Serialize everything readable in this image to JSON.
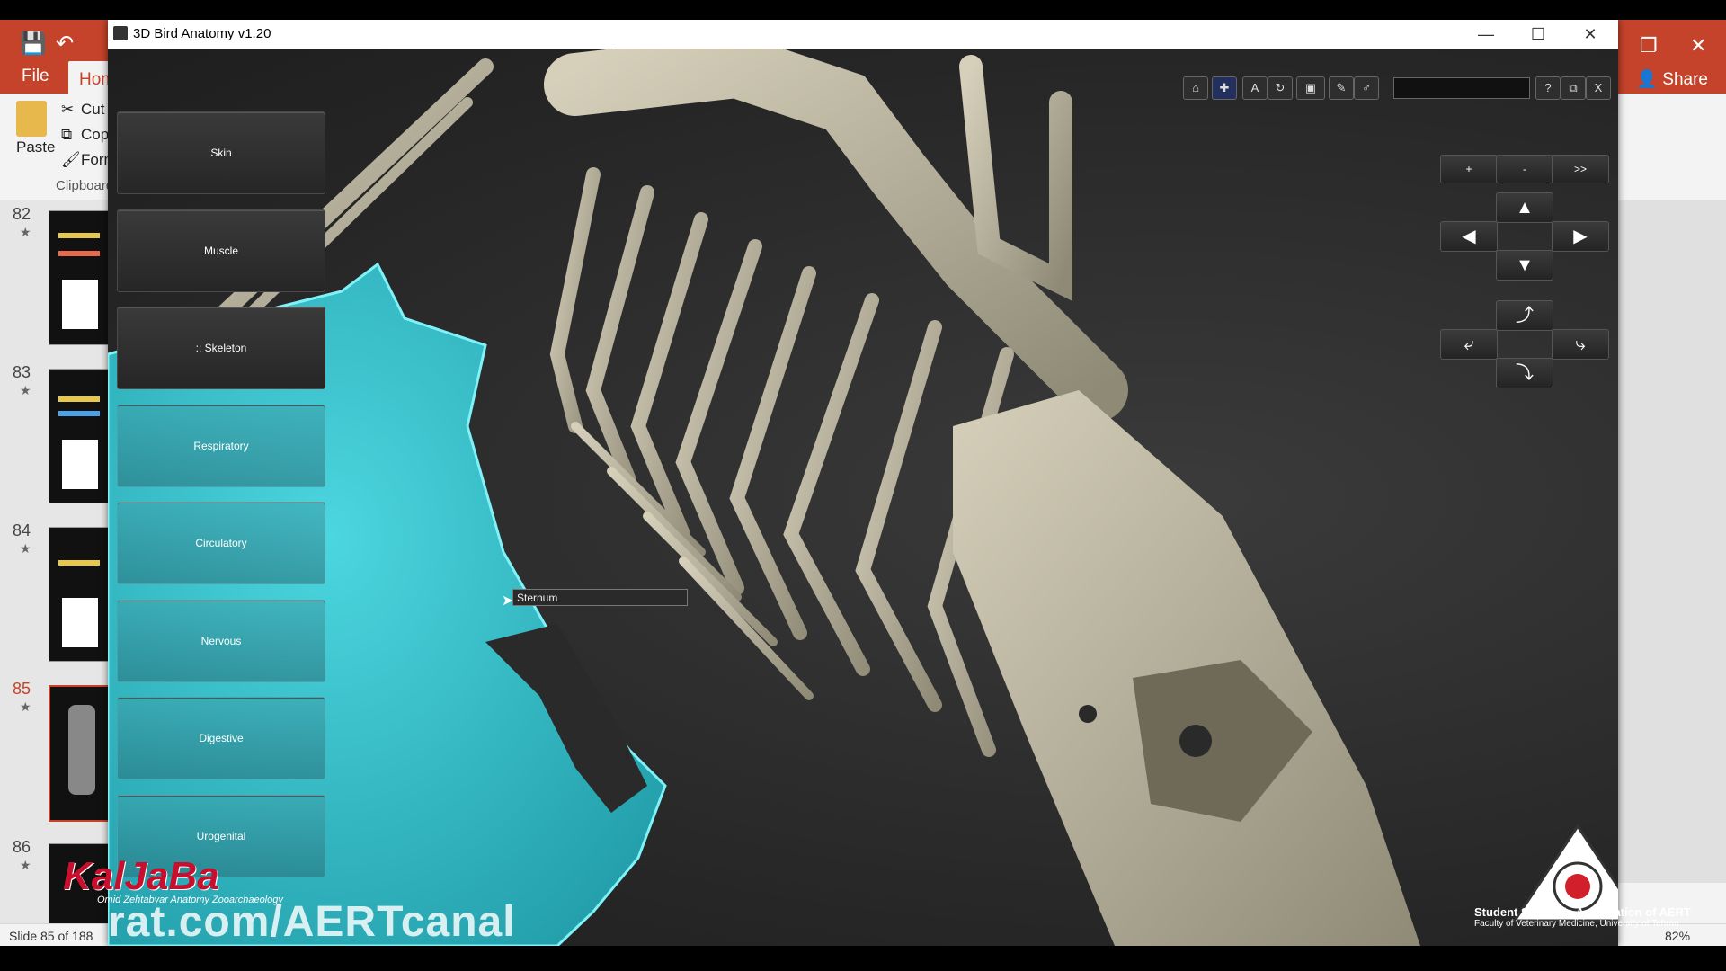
{
  "powerpoint": {
    "tabs": {
      "file": "File",
      "home": "Hom"
    },
    "share": "Share",
    "ribbon": {
      "paste": "Paste",
      "cut": "Cut",
      "copy": "Copy",
      "format": "Form",
      "group": "Clipboard"
    },
    "slides": [
      {
        "number": "82",
        "star": "★"
      },
      {
        "number": "83",
        "star": "★"
      },
      {
        "number": "84",
        "star": "★"
      },
      {
        "number": "85",
        "star": "★"
      },
      {
        "number": "86",
        "star": "★"
      }
    ],
    "status": "Slide 85 of 188",
    "zoom": "82%"
  },
  "app": {
    "title": "3D Bird Anatomy v1.20",
    "systems": [
      "Skin",
      "Muscle",
      ":: Skeleton",
      "Respiratory",
      "Circulatory",
      "Nervous",
      "Digestive",
      "Urogenital"
    ],
    "toolbar": {
      "help": "?",
      "close": "X"
    },
    "zoom_controls": {
      "plus": "+",
      "minus": "-",
      "next": ">>"
    },
    "tooltip": "Sternum",
    "selected_color": "#38c8d4",
    "bone_color": "#b7b19a"
  },
  "overlay": {
    "watermark": "rat.com/AERTcanal",
    "brand": "KalJaBa",
    "brand_sub": "Omid Zehtabvar Anatomy Zooarchaeology",
    "org_name": "Student Scientific Association of AERT",
    "org_sub": "Faculty of Veterinary Medicine, University of Tehran"
  }
}
